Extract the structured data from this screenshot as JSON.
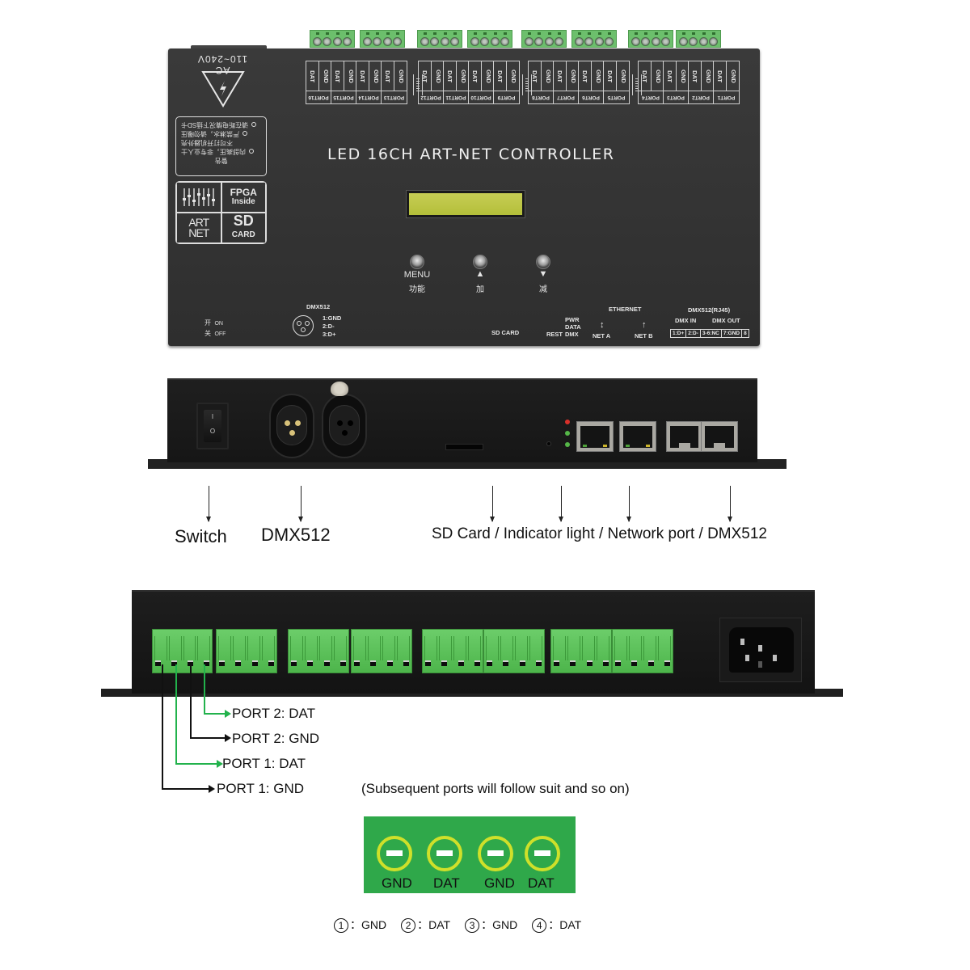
{
  "top_view": {
    "title": "LED 16CH ART-NET CONTROLLER",
    "power_rating": "AC 110~240V",
    "warning_lines": [
      "请在断电情况下插SD卡",
      "严禁淋水，请勿曝压",
      "不可打开机器外壳",
      "内部高压，非专业人士",
      "警告"
    ],
    "logos": {
      "fpga": "FPGA",
      "fpga_sub": "Inside",
      "artnet_top": "ART",
      "artnet_bottom": "NET",
      "sd": "SD",
      "sd_sub": "CARD"
    },
    "port_groups": [
      {
        "ports": [
          "PORT16",
          "PORT15",
          "PORT14",
          "PORT13"
        ]
      },
      {
        "ports": [
          "PORT12",
          "PORT11",
          "PORT10",
          "PORT9"
        ]
      },
      {
        "ports": [
          "PORT8",
          "PORT7",
          "PORT6",
          "PORT5"
        ]
      },
      {
        "ports": [
          "PORT4",
          "PORT3",
          "PORT2",
          "PORT1"
        ]
      }
    ],
    "pin_labels": [
      "DAT",
      "GND"
    ],
    "buttons": [
      {
        "label": "MENU",
        "cn": "功能",
        "symbol": ""
      },
      {
        "label": "",
        "cn": "加",
        "symbol": "▲"
      },
      {
        "label": "",
        "cn": "减",
        "symbol": "▼"
      }
    ],
    "switch_labels": {
      "on_cn": "开",
      "on": "ON",
      "off_cn": "关",
      "off": "OFF"
    },
    "dmx512": {
      "title": "DMX512",
      "pins": [
        "1:GND",
        "2:D-",
        "3:D+"
      ]
    },
    "sd_card": "SD CARD",
    "rest": "REST",
    "indicators": [
      "PWR",
      "DATA",
      "DMX"
    ],
    "ethernet": {
      "title": "ETHERNET",
      "net_a": "NET A",
      "net_b": "NET B"
    },
    "dmx_rj45": {
      "title": "DMX512(RJ45)",
      "in": "DMX IN",
      "out": "DMX OUT",
      "pins": [
        "1:D+",
        "2:D-",
        "3-6:NC",
        "7:GND",
        "8"
      ]
    }
  },
  "front_view": {
    "rocker_on": "I",
    "rocker_off": "O",
    "captions": {
      "switch": "Switch",
      "dmx512": "DMX512",
      "right": "SD Card / Indicator light / Network port / DMX512"
    },
    "led_colors": [
      "#d9302a",
      "#55b748",
      "#55b748"
    ]
  },
  "back_view": {
    "wiring": [
      {
        "label": "PORT 2:  DAT",
        "color": "#22b24c"
      },
      {
        "label": "PORT 2:  GND",
        "color": "#111111"
      },
      {
        "label": "PORT 1:  DAT",
        "color": "#22b24c"
      },
      {
        "label": "PORT 1:  GND",
        "color": "#111111"
      }
    ],
    "note": "(Subsequent ports will follow suit and so on)"
  },
  "terminal_diagram": {
    "labels": [
      "GND",
      "DAT",
      "GND",
      "DAT"
    ],
    "legend": [
      {
        "num": "1",
        "sep": "：",
        "label": "GND"
      },
      {
        "num": "2",
        "sep": "：",
        "label": "DAT"
      },
      {
        "num": "3",
        "sep": "：",
        "label": "GND"
      },
      {
        "num": "4",
        "sep": "：",
        "label": "DAT"
      }
    ]
  }
}
